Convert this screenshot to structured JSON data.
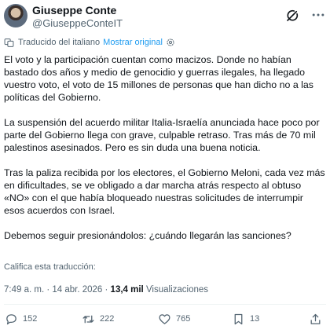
{
  "author": {
    "name": "Giuseppe Conte",
    "handle": "@GiuseppeConteIT"
  },
  "translation": {
    "label": "Traducido del italiano",
    "show_original": "Mostrar original"
  },
  "tweet": {
    "paragraphs": [
      "El voto y la participación cuentan como macizos. Donde no habían bastado dos años y medio de genocidio y guerras ilegales, ha llegado vuestro voto, el voto de 15 millones de personas que han dicho no a las políticas del Gobierno.",
      "La suspensión del acuerdo militar Italia-Israelía anunciada hace poco por parte del Gobierno llega con grave, culpable retraso. Tras más de 70 mil palestinos asesinados. Pero es sin duda una buena noticia.",
      "Tras la paliza recibida por los electores, el Gobierno Meloni, cada vez más en dificultades, se ve obligado a dar marcha atrás respecto al obtuso «NO» con el que había bloqueado nuestras solicitudes de interrumpir esos acuerdos con Israel.",
      "Debemos seguir presionándolos: ¿cuándo llegarán las sanciones?"
    ]
  },
  "rate_translation": "Califica esta traducción:",
  "meta": {
    "timestamp": "7:49 a. m. · 14 abr. 2026 ·",
    "views_count": "13,4 mil",
    "views_label": "Visualizaciones"
  },
  "actions": {
    "replies": "152",
    "reposts": "222",
    "likes": "765",
    "bookmarks": "13"
  },
  "icons": {
    "grok": "grok-icon",
    "more": "more-icon",
    "reply": "reply-icon",
    "repost": "repost-icon",
    "like": "heart-icon",
    "bookmark": "bookmark-icon",
    "share": "share-icon"
  }
}
